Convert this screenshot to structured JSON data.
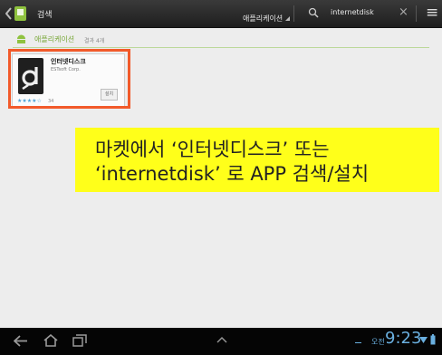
{
  "topbar": {
    "search_label": "검색",
    "filter_label": "애플리케이션",
    "query": "internetdisk",
    "clear_symbol": "×",
    "menu_symbol": "≡"
  },
  "results": {
    "category": "애플리케이션",
    "count_text": "결과 4개"
  },
  "app": {
    "name": "인터넷디스크",
    "developer": "ESTsoft Corp.",
    "stars": "★★★★☆",
    "rating_count": "34",
    "install_label": "설치"
  },
  "callout": {
    "line1": "마켓에서 ‘인터넷디스크’ 또는",
    "line2": "‘internetdisk’ 로 APP 검색/설치"
  },
  "status": {
    "ampm": "오전",
    "time": "9:23"
  },
  "colors": {
    "highlight_frame": "#f25a2a",
    "callout_bg": "#ffff1a"
  }
}
